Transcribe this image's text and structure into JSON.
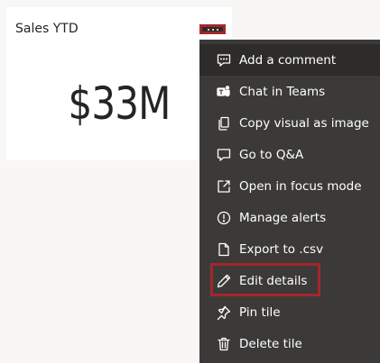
{
  "tile": {
    "title": "Sales YTD",
    "value": "$33M"
  },
  "more_options": {
    "icon": "more-options-icon"
  },
  "menu": {
    "items": [
      {
        "label": "Add a comment",
        "icon": "comment-icon"
      },
      {
        "label": "Chat in Teams",
        "icon": "teams-icon"
      },
      {
        "label": "Copy visual as image",
        "icon": "copy-icon"
      },
      {
        "label": "Go to Q&A",
        "icon": "qna-icon"
      },
      {
        "label": "Open in focus mode",
        "icon": "focus-mode-icon"
      },
      {
        "label": "Manage alerts",
        "icon": "alert-icon"
      },
      {
        "label": "Export to .csv",
        "icon": "export-icon"
      },
      {
        "label": "Edit details",
        "icon": "pencil-icon"
      },
      {
        "label": "Pin tile",
        "icon": "pin-icon"
      },
      {
        "label": "Delete tile",
        "icon": "trash-icon"
      }
    ]
  },
  "colors": {
    "highlight": "#a4262c",
    "menu_background": "#3b3a39",
    "menu_active_background": "#2d2c2b",
    "tile_background": "#ffffff",
    "page_background": "#f8f7f6"
  }
}
